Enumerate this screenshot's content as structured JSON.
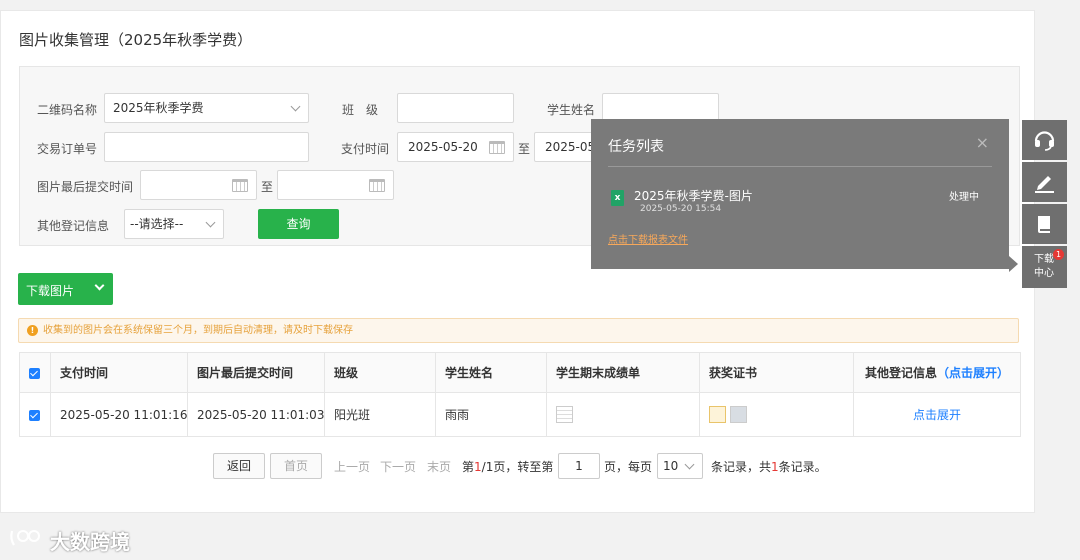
{
  "page_title": "图片收集管理（2025年秋季学费）",
  "filters": {
    "qrcode_label": "二维码名称",
    "qrcode_value": "2025年秋季学费",
    "class_label": "班　级",
    "student_label": "学生姓名",
    "order_label": "交易订单号",
    "pay_time_label": "支付时间",
    "pay_time_start": "2025-05-20",
    "pay_time_end": "2025-05-",
    "range_sep": "至",
    "submit_time_label": "图片最后提交时间",
    "other_label": "其他登记信息",
    "other_value": "--请选择--",
    "query_label": "查询"
  },
  "download_button": "下载图片",
  "notice": "收集到的图片会在系统保留三个月，到期后自动清理，请及时下载保存",
  "notice_icon": "!",
  "table": {
    "headers": [
      "支付时间",
      "图片最后提交时间",
      "班级",
      "学生姓名",
      "学生期末成绩单",
      "获奖证书",
      "其他登记信息"
    ],
    "expand_header": "（点击展开）",
    "rows": [
      {
        "pay_time": "2025-05-20 11:01:16",
        "submit_time": "2025-05-20 11:01:03",
        "class": "阳光班",
        "student": "雨雨",
        "expand": "点击展开"
      }
    ]
  },
  "pager": {
    "back": "返回",
    "first": "首页",
    "prev": "上一页",
    "next": "下一页",
    "last": "末页",
    "page_prefix": "第",
    "current": "1",
    "total_pages": "/1页，",
    "goto": "转至第",
    "goto_value": "1",
    "page_unit": "页，",
    "per_page_label": "每页",
    "per_page": "10",
    "records_unit": "条记录，",
    "total_prefix": "共",
    "total": "1",
    "total_suffix": "条记录。"
  },
  "task_popup": {
    "title": "任务列表",
    "close": "×",
    "file_icon": "x",
    "file_name": "2025年秋季学费-图片",
    "file_date": "2025-05-20 15:54",
    "status": "处理中",
    "link": "点击下载报表文件"
  },
  "sidebar": {
    "download_center": "下载中心",
    "badge": "1"
  },
  "watermark": "大数跨境",
  "colors": {
    "accent_green": "#28b24b",
    "link_blue": "#1e80ff",
    "popup_bg": "#7a7a7a"
  }
}
